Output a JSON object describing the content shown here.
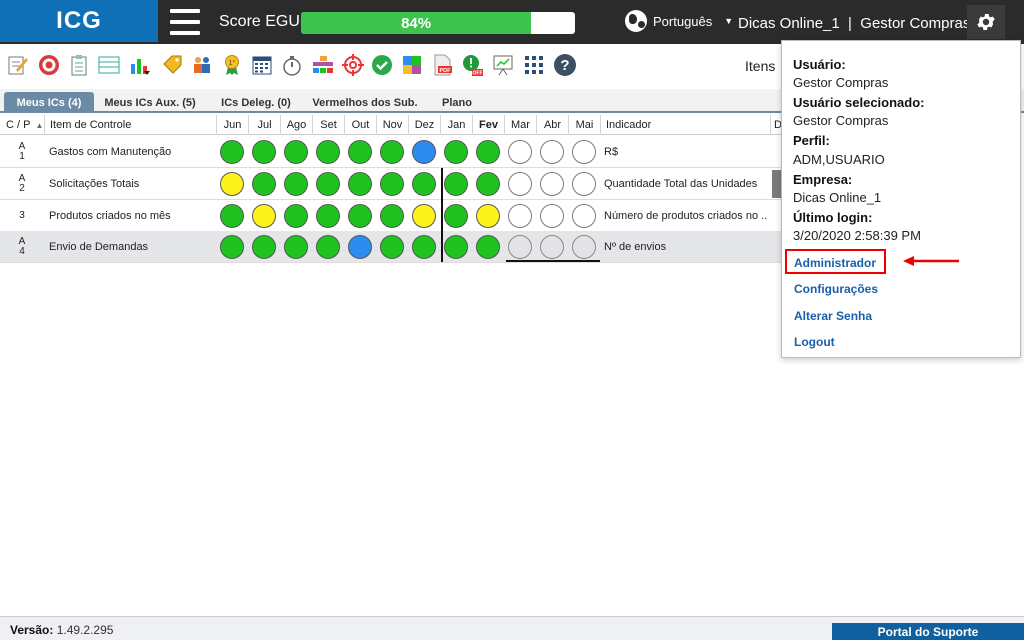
{
  "header": {
    "logo": "ICG",
    "score_label": "Score EGU:",
    "score_text": "84%",
    "score_fraction": 0.84,
    "language": "Português",
    "company_user": "Dicas Online_1  |  Gestor Compras"
  },
  "toolbar": {
    "icons": [
      "edit-icon",
      "target-icon",
      "clipboard-icon",
      "list-icon",
      "chart-down-icon",
      "tags-icon",
      "people-icon",
      "medal-icon",
      "calendar-icon",
      "stopwatch-icon",
      "hierarchy-icon",
      "crosshair-icon",
      "check-icon",
      "puzzle-icon",
      "pdf-icon",
      "alert-off-icon",
      "presentation-icon",
      "grid-icon",
      "help-icon"
    ],
    "itens_label": "Itens"
  },
  "tabs": [
    {
      "label": "Meus ICs (4)",
      "active": true
    },
    {
      "label": "Meus ICs Aux. (5)",
      "active": false
    },
    {
      "label": "ICs Deleg. (0)",
      "active": false
    },
    {
      "label": "Vermelhos dos Sub.",
      "active": false
    },
    {
      "label": "Plano",
      "active": false
    }
  ],
  "table": {
    "columns": {
      "cp": "C / P",
      "item": "Item de Controle",
      "months": [
        "Jun",
        "Jul",
        "Ago",
        "Set",
        "Out",
        "Nov",
        "Dez",
        "Jan",
        "Fev",
        "Mar",
        "Abr",
        "Mai"
      ],
      "indicador": "Indicador",
      "d": "D"
    },
    "rows": [
      {
        "cp1": "A",
        "cp2": "1",
        "item": "Gastos com Manutenção",
        "indicador": "R$",
        "status": [
          "green",
          "green",
          "green",
          "green",
          "green",
          "green",
          "blue",
          "green",
          "green",
          "empty",
          "empty",
          "empty"
        ]
      },
      {
        "cp1": "A",
        "cp2": "2",
        "item": "Solicitações Totais",
        "indicador": "Quantidade Total das Unidades",
        "status": [
          "yellow",
          "green",
          "green",
          "green",
          "green",
          "green",
          "green",
          "green",
          "green",
          "empty",
          "empty",
          "empty"
        ]
      },
      {
        "cp1": "",
        "cp2": "3",
        "item": "Produtos criados no mês",
        "indicador": "Número de produtos criados no ...",
        "status": [
          "green",
          "yellow",
          "green",
          "green",
          "green",
          "green",
          "yellow",
          "green",
          "yellow",
          "empty",
          "empty",
          "empty"
        ]
      },
      {
        "cp1": "A",
        "cp2": "4",
        "item": "Envio de Demandas",
        "indicador": "Nº de envios",
        "status": [
          "green",
          "green",
          "green",
          "green",
          "blue",
          "green",
          "green",
          "green",
          "green",
          "grey",
          "grey",
          "grey"
        ]
      }
    ]
  },
  "dropdown": {
    "usuario_label": "Usuário:",
    "usuario_value": "Gestor Compras",
    "selecionado_label": "Usuário selecionado:",
    "selecionado_value": "Gestor Compras",
    "perfil_label": "Perfil:",
    "perfil_value": "ADM,USUARIO",
    "empresa_label": "Empresa:",
    "empresa_value": "Dicas Online_1",
    "login_label": "Último login:",
    "login_value": "3/20/2020 2:58:39 PM",
    "links": [
      "Administrador",
      "Configurações",
      "Alterar Senha",
      "Logout"
    ]
  },
  "footer": {
    "version_label": "Versão:",
    "version_value": "1.49.2.295",
    "portal": "Portal do Suporte"
  },
  "colors": {
    "brand": "#0f6fb7",
    "green": "#1ec31e",
    "yellow": "#fbf31a",
    "blue": "#2c8cf1",
    "highlight": "#e00000"
  }
}
